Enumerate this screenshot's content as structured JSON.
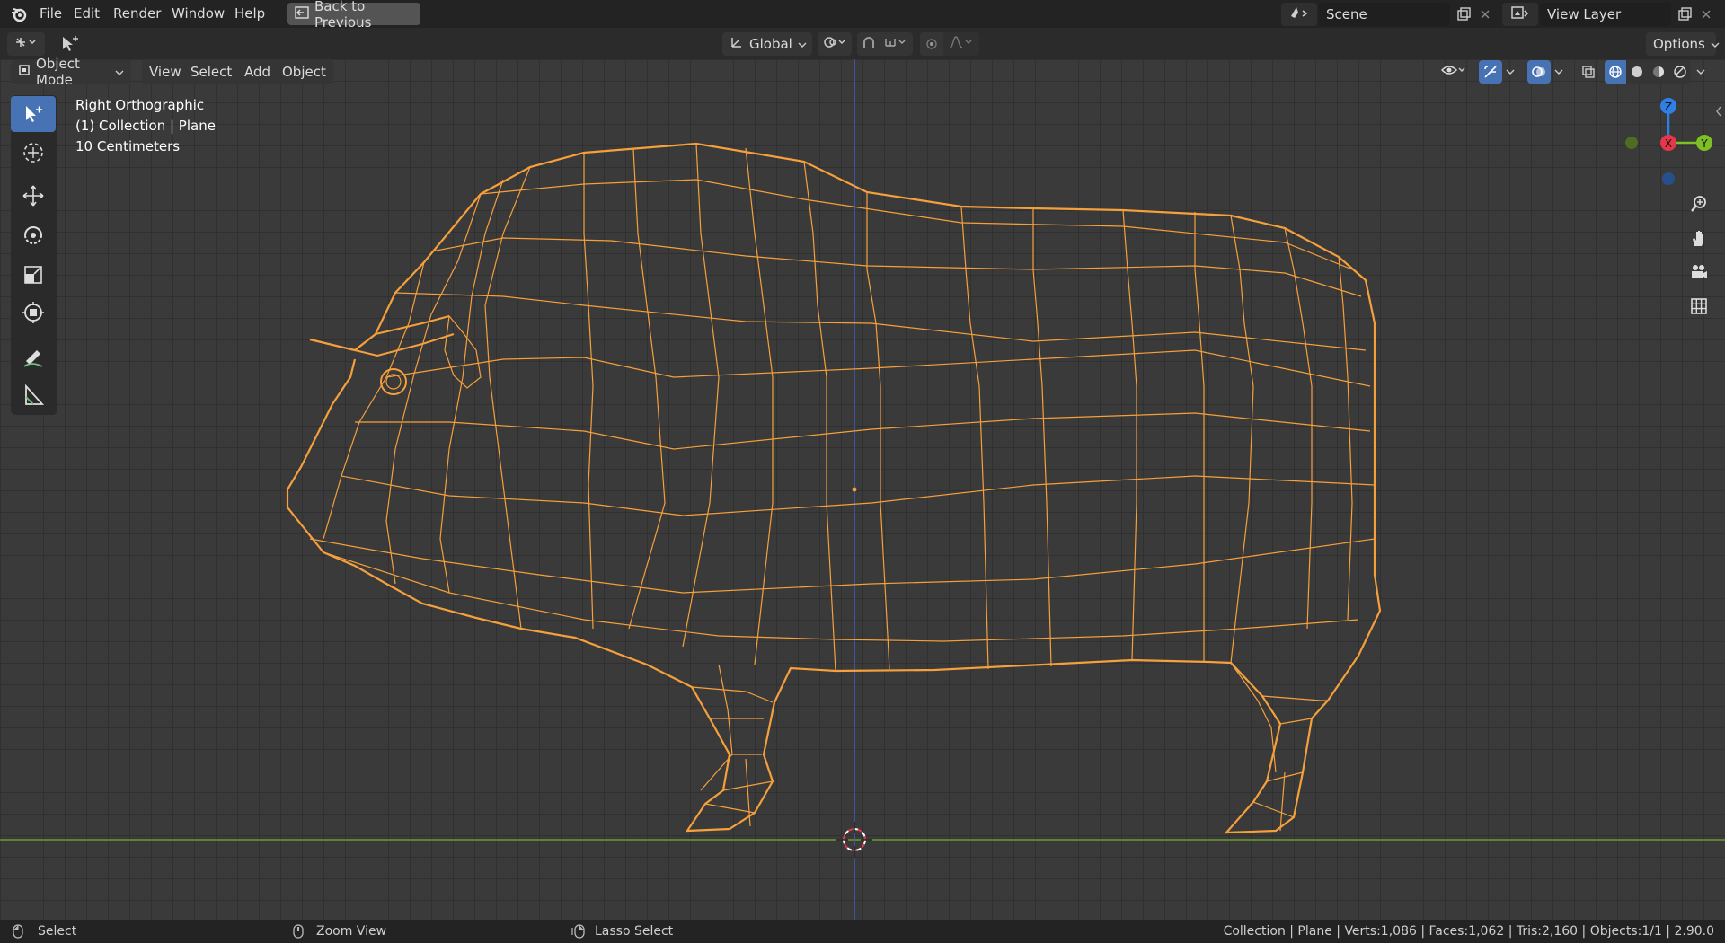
{
  "menu": {
    "items": [
      "File",
      "Edit",
      "Render",
      "Window",
      "Help"
    ],
    "back_label": "Back to Previous"
  },
  "scene": {
    "label": "Scene",
    "view_layer": "View Layer"
  },
  "toolheader": {
    "orientation": "Global",
    "options": "Options"
  },
  "viewport_header": {
    "mode": "Object Mode",
    "menus": [
      "View",
      "Select",
      "Add",
      "Object"
    ]
  },
  "overlay": {
    "view_name": "Right Orthographic",
    "collection": "(1) Collection | Plane",
    "scale": "10 Centimeters"
  },
  "gizmo": {
    "z": "Z",
    "x": "X",
    "y": "Y"
  },
  "status": {
    "select": "Select",
    "zoom": "Zoom View",
    "lasso": "Lasso Select",
    "stats": "Collection | Plane | Verts:1,086 | Faces:1,062 | Tris:2,160 | Objects:1/1 | 2.90.0"
  },
  "colors": {
    "accent": "#4772b3",
    "wire": "#f5a03c",
    "axis_x": "#e6374a",
    "axis_y": "#7dbf25",
    "axis_z": "#2f7fe6"
  }
}
